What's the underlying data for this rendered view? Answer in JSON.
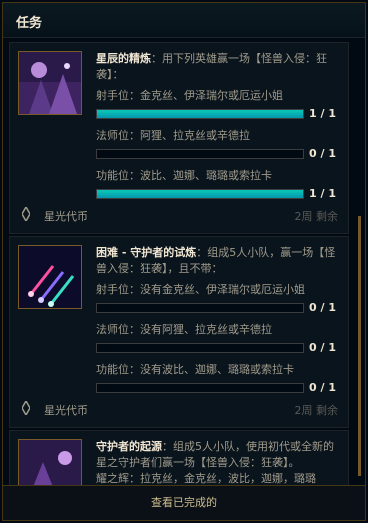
{
  "header": {
    "title": "任务"
  },
  "missions": [
    {
      "name": "星辰的精炼",
      "desc": "：用下列英雄赢一场【怪兽入侵：狂袭】：",
      "objectives": [
        {
          "label": "射手位：金克丝、伊泽瑞尔或厄运小姐",
          "count": "1 / 1",
          "progress": 1.0
        },
        {
          "label": "法师位：阿狸、拉克丝或辛德拉",
          "count": "0 / 1",
          "progress": 0.0
        },
        {
          "label": "功能位：波比、迦娜、璐璐或索拉卡",
          "count": "1 / 1",
          "progress": 1.0
        }
      ],
      "reward": "星光代币",
      "time": "2周 剩余"
    },
    {
      "name": "困难 - 守护者的试炼",
      "desc": "：组成5人小队，赢一场【怪兽入侵：狂袭】，且不带：",
      "objectives": [
        {
          "label": "射手位：没有金克丝、伊泽瑞尔或厄运小姐",
          "count": "0 / 1",
          "progress": 0.0
        },
        {
          "label": "法师位：没有阿狸、拉克丝或辛德拉",
          "count": "0 / 1",
          "progress": 0.0
        },
        {
          "label": "功能位：没有波比、迦娜、璐璐或索拉卡",
          "count": "0 / 1",
          "progress": 0.0
        }
      ],
      "reward": "星光代币",
      "time": "2周 剩余"
    },
    {
      "name": "守护者的起源",
      "desc": "：组成5人小队，使用初代或全新的星之守护者们赢一场【怪兽入侵：狂袭】。",
      "objective_line": "耀之辉：拉克丝，金克丝，波比，迦娜，璐璐"
    }
  ],
  "footer": {
    "view_completed": "查看已完成的"
  },
  "colors": {
    "bar_fill": "#0ac8b9",
    "gold": "#785a28"
  }
}
